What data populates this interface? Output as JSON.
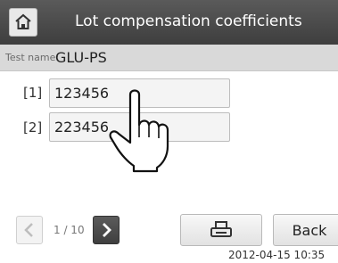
{
  "header": {
    "title": "Lot compensation coefficients",
    "home_icon": "home-icon"
  },
  "test": {
    "label": "Test name:",
    "value": "GLU-PS"
  },
  "coefficients": [
    {
      "index": "[1]",
      "value": "123456"
    },
    {
      "index": "[2]",
      "value": "223456"
    }
  ],
  "pagination": {
    "indicator": "1 / 10"
  },
  "actions": {
    "print_icon": "printer-icon",
    "back_label": "Back"
  },
  "status": {
    "datetime": "2012-04-15 10:35"
  }
}
